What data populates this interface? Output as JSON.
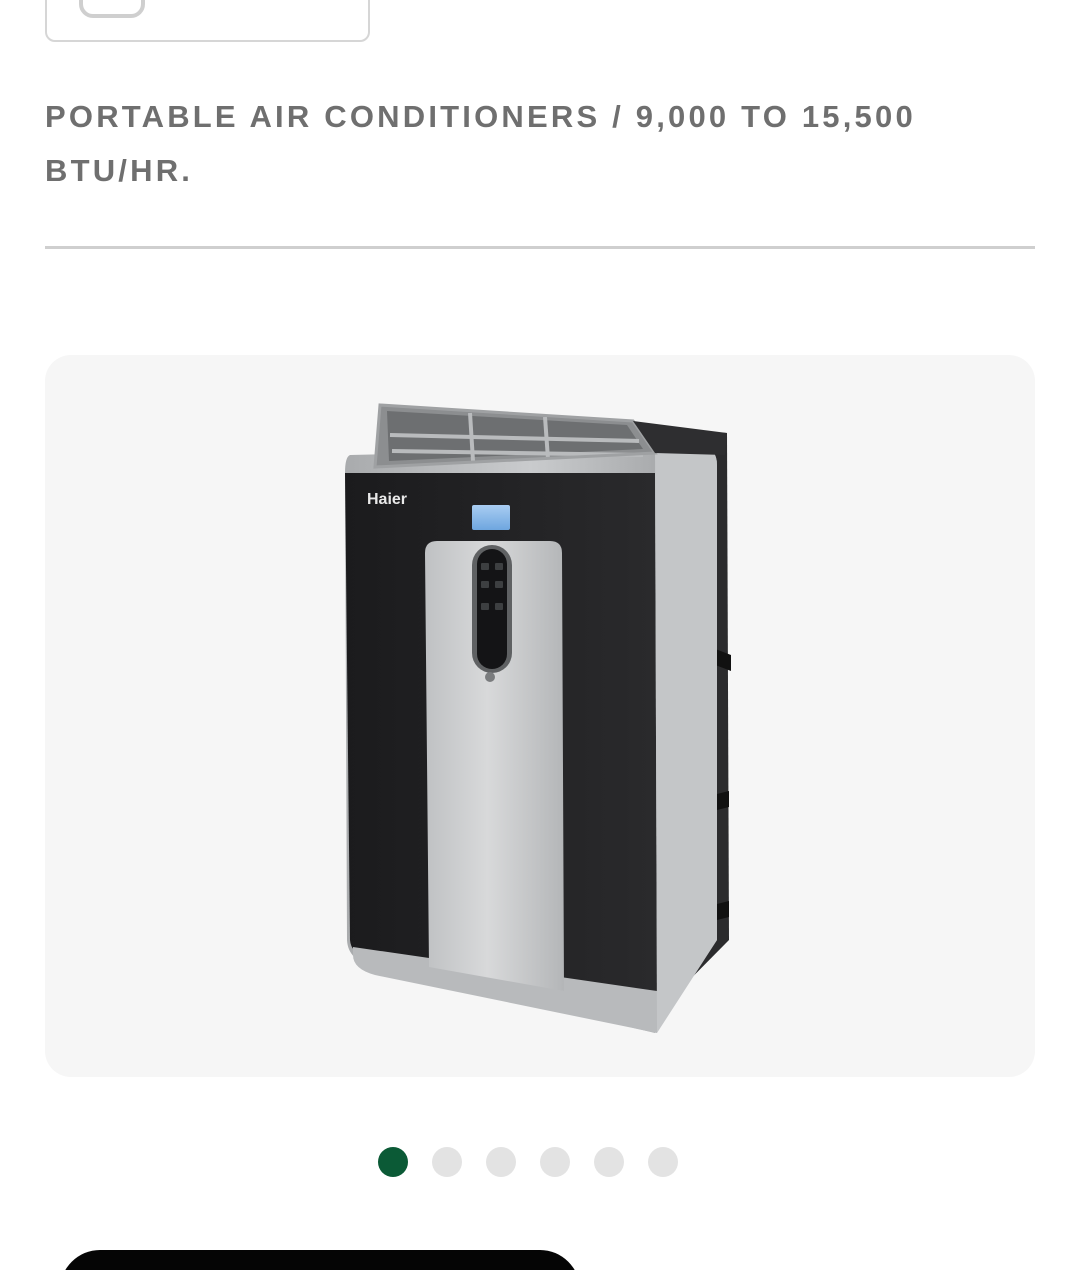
{
  "breadcrumb": {
    "text": "PORTABLE AIR CONDITIONERS / 9,000 TO 15,500 BTU/HR."
  },
  "product_image": {
    "brand_mark": "Haier"
  },
  "carousel": {
    "total": 6,
    "active_index": 0,
    "active_color": "#0b5a36",
    "inactive_color": "#e3e3e3"
  }
}
